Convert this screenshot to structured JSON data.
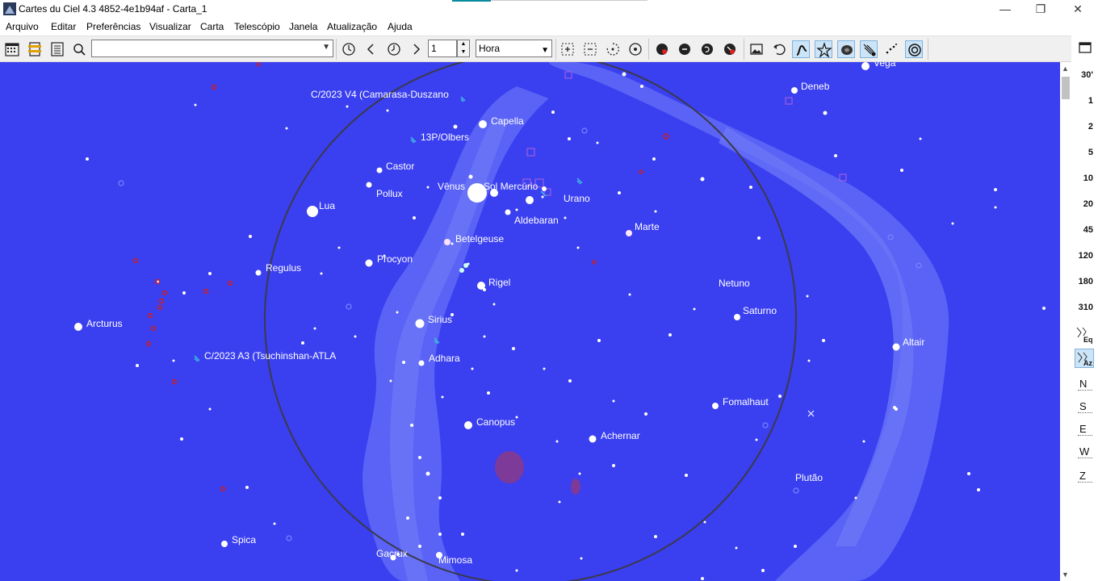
{
  "window": {
    "title": "Cartes du Ciel 4.3 4852-4e1b94af - Carta_1",
    "minimize": "—",
    "maximize": "❐",
    "close": "✕"
  },
  "menu": [
    "Arquivo",
    "Editar",
    "Preferências",
    "Visualizar",
    "Carta",
    "Telescópio",
    "Janela",
    "Atualização",
    "Ajuda"
  ],
  "toolbar": {
    "search_value": "",
    "step_value": "1",
    "step_unit": "Hora"
  },
  "fov_buttons": [
    "30'",
    "1",
    "2",
    "5",
    "10",
    "20",
    "45",
    "120",
    "180",
    "310"
  ],
  "projection_buttons": {
    "eq": "Eq",
    "az": "Az"
  },
  "direction_buttons": [
    "N",
    "S",
    "E",
    "W",
    "Z"
  ],
  "colors": {
    "sky": "#3a3ff0",
    "milky_way": "#5a63f5",
    "horizon": "#3a3a4a",
    "label": "#ffffff",
    "toolbar_active": "#cce4f7"
  },
  "sky_labels": {
    "vega": "Vega",
    "deneb": "Deneb",
    "capella": "Capella",
    "comet_v4": "C/2023 V4 (Camarasa-Duszano",
    "comet_13p": "13P/Olbers",
    "castor": "Castor",
    "pollux": "Pollux",
    "venus": "Vênus",
    "sol_mercurio": "Sol Mercúrio",
    "lua": "Lua",
    "urano": "Urano",
    "aldebaran": "Aldebaran",
    "marte": "Marte",
    "betelgeuse": "Betelgeuse",
    "regulus": "Regulus",
    "procyon": "Procyon",
    "rigel": "Rigel",
    "netuno": "Netuno",
    "saturno": "Saturno",
    "arcturus": "Arcturus",
    "sirius": "Sirius",
    "altair": "Altair",
    "comet_a3": "C/2023 A3 (Tsuchinshan-ATLA",
    "adhara": "Adhara",
    "fomalhaut": "Fomalhaut",
    "canopus": "Canopus",
    "achernar": "Achernar",
    "plutao": "Plutão",
    "spica": "Spica",
    "gacrux": "Gacrux",
    "mimosa": "Mimosa"
  }
}
